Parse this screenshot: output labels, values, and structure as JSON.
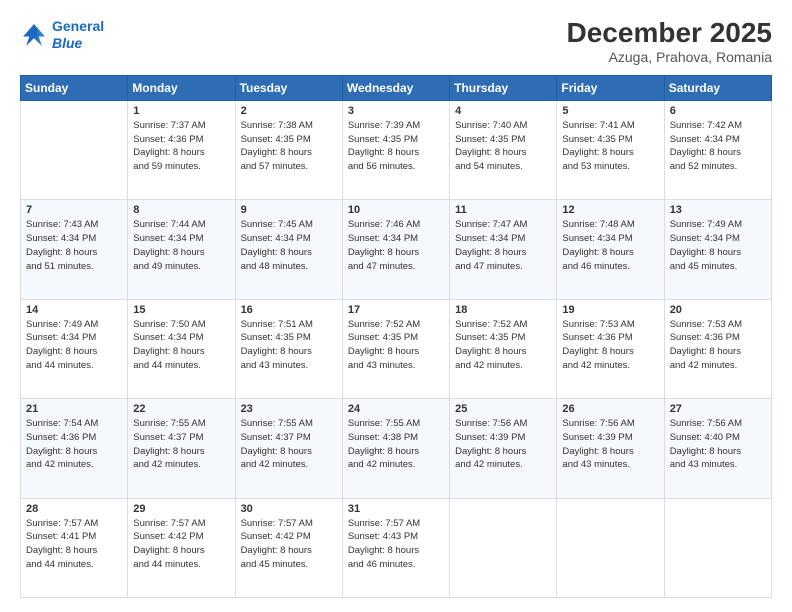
{
  "logo": {
    "line1": "General",
    "line2": "Blue"
  },
  "title": "December 2025",
  "subtitle": "Azuga, Prahova, Romania",
  "weekdays": [
    "Sunday",
    "Monday",
    "Tuesday",
    "Wednesday",
    "Thursday",
    "Friday",
    "Saturday"
  ],
  "weeks": [
    [
      {
        "num": "",
        "info": ""
      },
      {
        "num": "1",
        "info": "Sunrise: 7:37 AM\nSunset: 4:36 PM\nDaylight: 8 hours\nand 59 minutes."
      },
      {
        "num": "2",
        "info": "Sunrise: 7:38 AM\nSunset: 4:35 PM\nDaylight: 8 hours\nand 57 minutes."
      },
      {
        "num": "3",
        "info": "Sunrise: 7:39 AM\nSunset: 4:35 PM\nDaylight: 8 hours\nand 56 minutes."
      },
      {
        "num": "4",
        "info": "Sunrise: 7:40 AM\nSunset: 4:35 PM\nDaylight: 8 hours\nand 54 minutes."
      },
      {
        "num": "5",
        "info": "Sunrise: 7:41 AM\nSunset: 4:35 PM\nDaylight: 8 hours\nand 53 minutes."
      },
      {
        "num": "6",
        "info": "Sunrise: 7:42 AM\nSunset: 4:34 PM\nDaylight: 8 hours\nand 52 minutes."
      }
    ],
    [
      {
        "num": "7",
        "info": "Sunrise: 7:43 AM\nSunset: 4:34 PM\nDaylight: 8 hours\nand 51 minutes."
      },
      {
        "num": "8",
        "info": "Sunrise: 7:44 AM\nSunset: 4:34 PM\nDaylight: 8 hours\nand 49 minutes."
      },
      {
        "num": "9",
        "info": "Sunrise: 7:45 AM\nSunset: 4:34 PM\nDaylight: 8 hours\nand 48 minutes."
      },
      {
        "num": "10",
        "info": "Sunrise: 7:46 AM\nSunset: 4:34 PM\nDaylight: 8 hours\nand 47 minutes."
      },
      {
        "num": "11",
        "info": "Sunrise: 7:47 AM\nSunset: 4:34 PM\nDaylight: 8 hours\nand 47 minutes."
      },
      {
        "num": "12",
        "info": "Sunrise: 7:48 AM\nSunset: 4:34 PM\nDaylight: 8 hours\nand 46 minutes."
      },
      {
        "num": "13",
        "info": "Sunrise: 7:49 AM\nSunset: 4:34 PM\nDaylight: 8 hours\nand 45 minutes."
      }
    ],
    [
      {
        "num": "14",
        "info": "Sunrise: 7:49 AM\nSunset: 4:34 PM\nDaylight: 8 hours\nand 44 minutes."
      },
      {
        "num": "15",
        "info": "Sunrise: 7:50 AM\nSunset: 4:34 PM\nDaylight: 8 hours\nand 44 minutes."
      },
      {
        "num": "16",
        "info": "Sunrise: 7:51 AM\nSunset: 4:35 PM\nDaylight: 8 hours\nand 43 minutes."
      },
      {
        "num": "17",
        "info": "Sunrise: 7:52 AM\nSunset: 4:35 PM\nDaylight: 8 hours\nand 43 minutes."
      },
      {
        "num": "18",
        "info": "Sunrise: 7:52 AM\nSunset: 4:35 PM\nDaylight: 8 hours\nand 42 minutes."
      },
      {
        "num": "19",
        "info": "Sunrise: 7:53 AM\nSunset: 4:36 PM\nDaylight: 8 hours\nand 42 minutes."
      },
      {
        "num": "20",
        "info": "Sunrise: 7:53 AM\nSunset: 4:36 PM\nDaylight: 8 hours\nand 42 minutes."
      }
    ],
    [
      {
        "num": "21",
        "info": "Sunrise: 7:54 AM\nSunset: 4:36 PM\nDaylight: 8 hours\nand 42 minutes."
      },
      {
        "num": "22",
        "info": "Sunrise: 7:55 AM\nSunset: 4:37 PM\nDaylight: 8 hours\nand 42 minutes."
      },
      {
        "num": "23",
        "info": "Sunrise: 7:55 AM\nSunset: 4:37 PM\nDaylight: 8 hours\nand 42 minutes."
      },
      {
        "num": "24",
        "info": "Sunrise: 7:55 AM\nSunset: 4:38 PM\nDaylight: 8 hours\nand 42 minutes."
      },
      {
        "num": "25",
        "info": "Sunrise: 7:56 AM\nSunset: 4:39 PM\nDaylight: 8 hours\nand 42 minutes."
      },
      {
        "num": "26",
        "info": "Sunrise: 7:56 AM\nSunset: 4:39 PM\nDaylight: 8 hours\nand 43 minutes."
      },
      {
        "num": "27",
        "info": "Sunrise: 7:56 AM\nSunset: 4:40 PM\nDaylight: 8 hours\nand 43 minutes."
      }
    ],
    [
      {
        "num": "28",
        "info": "Sunrise: 7:57 AM\nSunset: 4:41 PM\nDaylight: 8 hours\nand 44 minutes."
      },
      {
        "num": "29",
        "info": "Sunrise: 7:57 AM\nSunset: 4:42 PM\nDaylight: 8 hours\nand 44 minutes."
      },
      {
        "num": "30",
        "info": "Sunrise: 7:57 AM\nSunset: 4:42 PM\nDaylight: 8 hours\nand 45 minutes."
      },
      {
        "num": "31",
        "info": "Sunrise: 7:57 AM\nSunset: 4:43 PM\nDaylight: 8 hours\nand 46 minutes."
      },
      {
        "num": "",
        "info": ""
      },
      {
        "num": "",
        "info": ""
      },
      {
        "num": "",
        "info": ""
      }
    ]
  ]
}
